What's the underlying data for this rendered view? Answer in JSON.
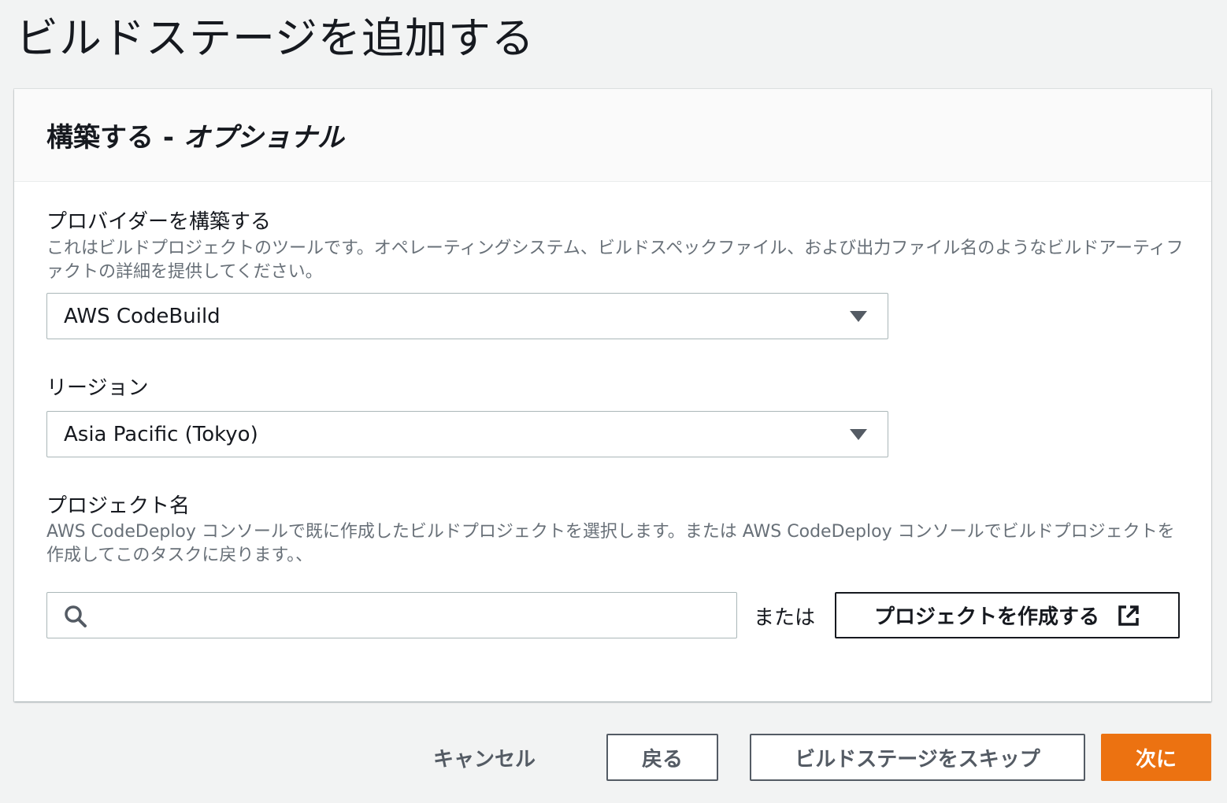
{
  "page": {
    "title": "ビルドステージを追加する"
  },
  "panel": {
    "title_main": "構築する - ",
    "title_optional": "オプショナル"
  },
  "provider": {
    "label": "プロバイダーを構築する",
    "description": "これはビルドプロジェクトのツールです。オペレーティングシステム、ビルドスペックファイル、および出力ファイル名のようなビルドアーティファクトの詳細を提供してください。",
    "selected": "AWS CodeBuild"
  },
  "region": {
    "label": "リージョン",
    "selected": "Asia Pacific (Tokyo)"
  },
  "project": {
    "label": "プロジェクト名",
    "description": "AWS CodeDeploy コンソールで既に作成したビルドプロジェクトを選択します。または AWS CodeDeploy コンソールでビルドプロジェクトを作成してこのタスクに戻ります。、",
    "search_value": "",
    "or_text": "または",
    "create_button_label": "プロジェクトを作成する"
  },
  "footer": {
    "cancel_label": "キャンセル",
    "back_label": "戻る",
    "skip_label": "ビルドステージをスキップ",
    "next_label": "次に"
  },
  "icons": {
    "search": "search-icon",
    "external_link": "external-link-icon",
    "dropdown": "caret-down-icon"
  },
  "colors": {
    "primary_button": "#ec7211",
    "background": "#f2f3f3",
    "description_text": "#687078"
  }
}
